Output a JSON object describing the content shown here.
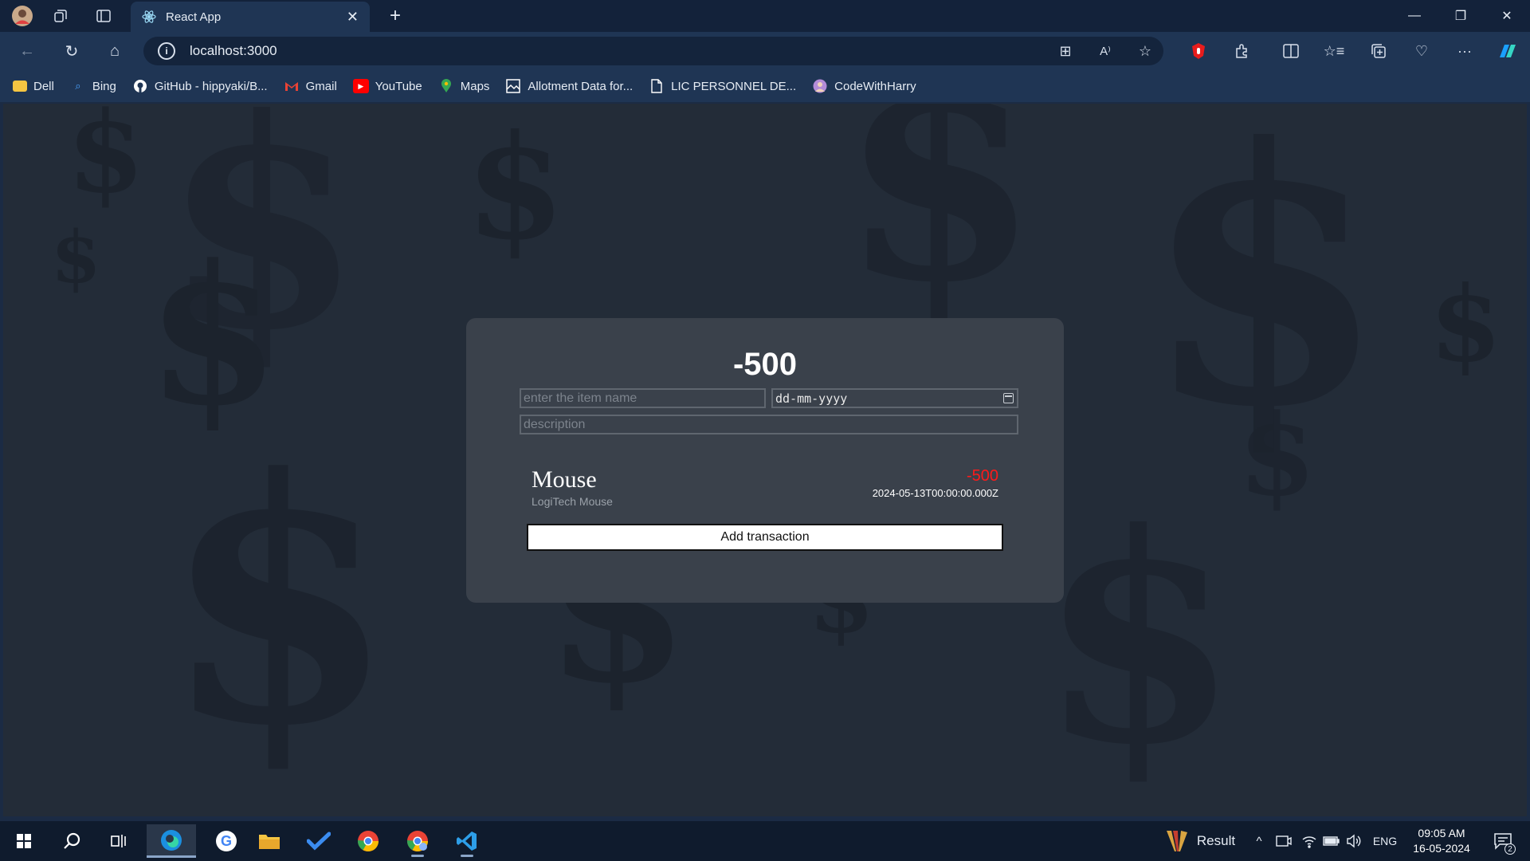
{
  "browser": {
    "tab_title": "React App",
    "url": "localhost:3000",
    "bookmarks": [
      {
        "label": "Dell",
        "icon": "folder-icon",
        "color": "#f5c542"
      },
      {
        "label": "Bing",
        "icon": "search-icon",
        "color": "#4aa3ff"
      },
      {
        "label": "GitHub - hippyaki/B...",
        "icon": "github-icon",
        "color": "#ffffff"
      },
      {
        "label": "Gmail",
        "icon": "gmail-icon",
        "color": "#ea4335"
      },
      {
        "label": "YouTube",
        "icon": "youtube-icon",
        "color": "#ff0000"
      },
      {
        "label": "Maps",
        "icon": "maps-icon",
        "color": "#34a853"
      },
      {
        "label": "Allotment Data for...",
        "icon": "image-icon",
        "color": "#ffffff"
      },
      {
        "label": "LIC PERSONNEL DE...",
        "icon": "document-icon",
        "color": "#ffffff"
      },
      {
        "label": "CodeWithHarry",
        "icon": "avatar-icon",
        "color": "#b48cd8"
      }
    ]
  },
  "app": {
    "balance": "-500",
    "name_placeholder": "enter the item name",
    "date_placeholder": "dd-mm-yyyy",
    "description_placeholder": "description",
    "transaction": {
      "name": "Mouse",
      "description": "LogiTech Mouse",
      "price": "-500",
      "datetime": "2024-05-13T00:00:00.000Z"
    },
    "add_button": "Add transaction",
    "colors": {
      "negative": "#ff1a1a",
      "card": "#3a414b",
      "background": "#232c38"
    }
  },
  "taskbar": {
    "result_label": "Result",
    "language": "ENG",
    "time": "09:05 AM",
    "date": "16-05-2024",
    "notification_count": "2"
  }
}
